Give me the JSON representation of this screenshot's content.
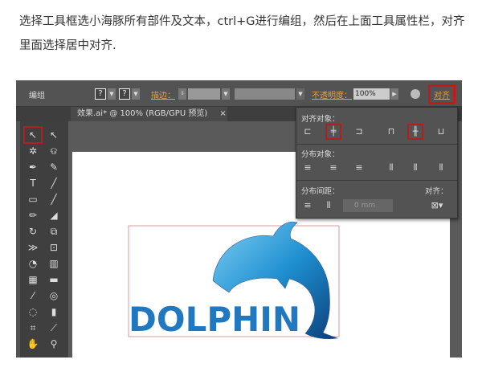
{
  "instruction": "选择工具框选小海豚所有部件及文本，ctrl+G进行编组，然后在上面工具属性栏，对齐里面选择居中对齐.",
  "toolbar": {
    "group_label": "编组",
    "stroke_label": "描边：",
    "opacity_label": "不透明度：",
    "opacity_value": "100%",
    "align_label": "对齐",
    "q1": "?",
    "q2": "?"
  },
  "tab": {
    "title": "效果.ai* @ 100% (RGB/GPU 预览)",
    "close": "×"
  },
  "align_panel": {
    "align_objects": "对齐对象：",
    "distribute_objects": "分布对象：",
    "distribute_spacing": "分布间距：",
    "align_to": "对齐：",
    "spacing_value": "0 mm"
  },
  "artwork": {
    "text": "DOLPHIN"
  },
  "colors": {
    "accent": "#c81818",
    "dolphin": "#1f8fd0"
  }
}
